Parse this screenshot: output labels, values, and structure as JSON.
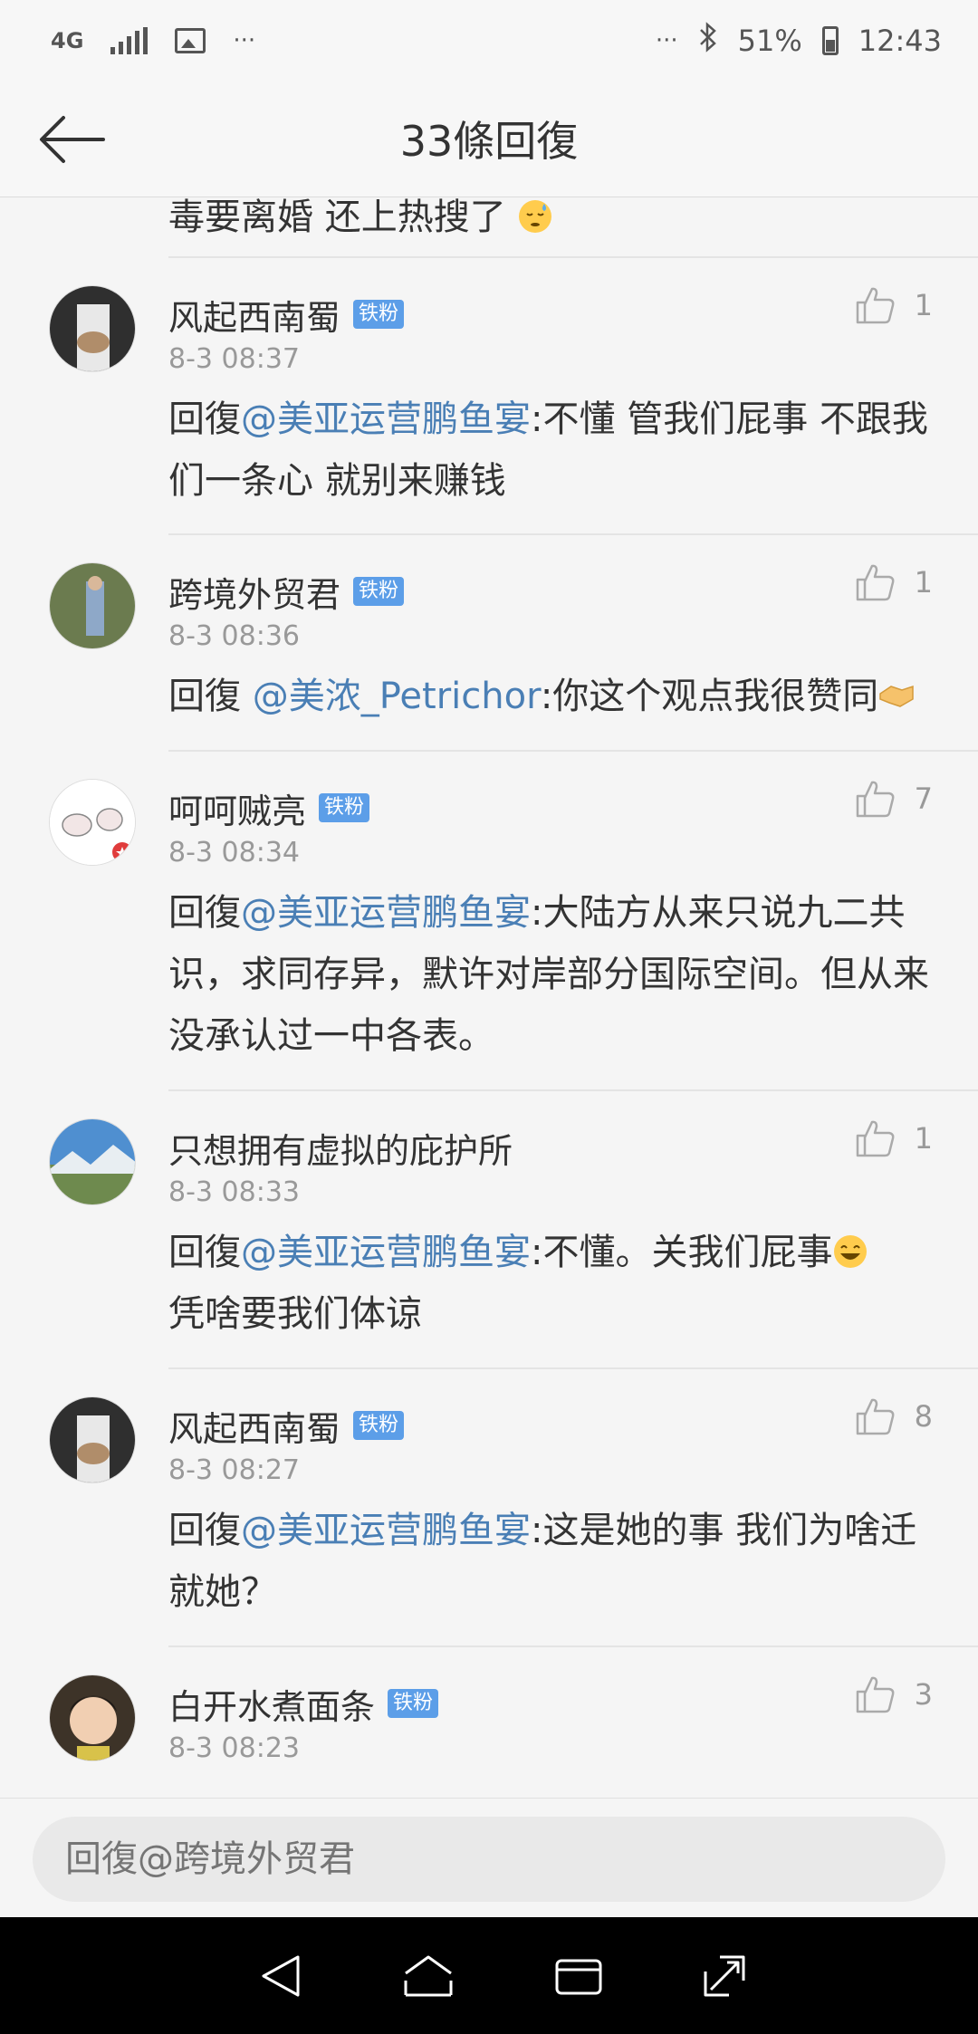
{
  "status_bar": {
    "network": "4G",
    "battery": "51%",
    "time": "12:43",
    "more": "···"
  },
  "header": {
    "title": "33條回復"
  },
  "partial_comment": {
    "text": "毒要离婚 还上热搜了"
  },
  "comments": [
    {
      "name": "风起西南蜀",
      "badge": "铁粉",
      "time": "8-3 08:37",
      "likes": "1",
      "prefix": "回復",
      "mention": "@美亚运营鹏鱼宴",
      "body": ":不懂 管我们屁事 不跟我们一条心 就别来赚钱"
    },
    {
      "name": "跨境外贸君",
      "badge": "铁粉",
      "time": "8-3 08:36",
      "likes": "1",
      "prefix": "回復 ",
      "mention": "@美浓_Petrichor",
      "body": ":你这个观点我很赞同"
    },
    {
      "name": "呵呵贼亮",
      "badge": "铁粉",
      "time": "8-3 08:34",
      "likes": "7",
      "prefix": "回復",
      "mention": "@美亚运营鹏鱼宴",
      "body": ":大陆方从来只说九二共识，求同存异，默许对岸部分国际空间。但从来没承认过一中各表。"
    },
    {
      "name": "只想拥有虚拟的庇护所",
      "badge": "",
      "time": "8-3 08:33",
      "likes": "1",
      "prefix": "回復",
      "mention": "@美亚运营鹏鱼宴",
      "body": ":不懂。关我们屁事"
    },
    {
      "name": "风起西南蜀",
      "badge": "铁粉",
      "time": "8-3 08:27",
      "likes": "8",
      "prefix": "回復",
      "mention": "@美亚运营鹏鱼宴",
      "body": ":这是她的事 我们为啥迁就她？"
    },
    {
      "name": "白开水煮面条",
      "badge": "铁粉",
      "time": "8-3 08:23",
      "likes": "3",
      "prefix": "",
      "mention": "",
      "body": ""
    }
  ],
  "comment4_line2": "凭啥要我们体谅",
  "reply_bar": {
    "placeholder": "回復@跨境外贸君"
  },
  "colors": {
    "mention": "#4a7fb5",
    "badge": "#5c9ee8"
  },
  "icons": [
    "back-arrow-icon",
    "thumbs-up-icon",
    "nav-back-icon",
    "nav-home-icon",
    "nav-recents-icon",
    "nav-expand-icon"
  ]
}
